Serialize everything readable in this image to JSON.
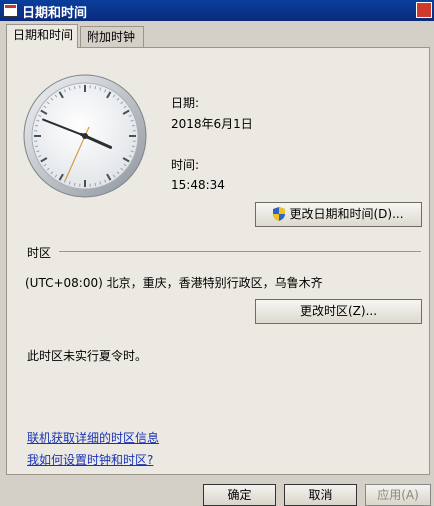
{
  "window": {
    "title": "日期和时间"
  },
  "tabs": [
    "日期和时间",
    "附加时钟"
  ],
  "date": {
    "label": "日期:",
    "value": "2018年6月1日"
  },
  "time": {
    "label": "时间:",
    "value": "15:48:34"
  },
  "clock": {
    "hours": 15,
    "minutes": 48,
    "seconds": 34
  },
  "buttons": {
    "change_datetime": "更改日期和时间(D)...",
    "change_timezone": "更改时区(Z)..."
  },
  "timezone": {
    "section_label": "时区",
    "value": "(UTC+08:00) 北京，重庆，香港特别行政区，乌鲁木齐",
    "dst_note": "此时区未实行夏令时。"
  },
  "links": {
    "online_info": "联机获取详细的时区信息",
    "how_to_set": "我如何设置时钟和时区?"
  },
  "footer": {
    "ok": "确定",
    "cancel": "取消",
    "apply": "应用(A)"
  }
}
